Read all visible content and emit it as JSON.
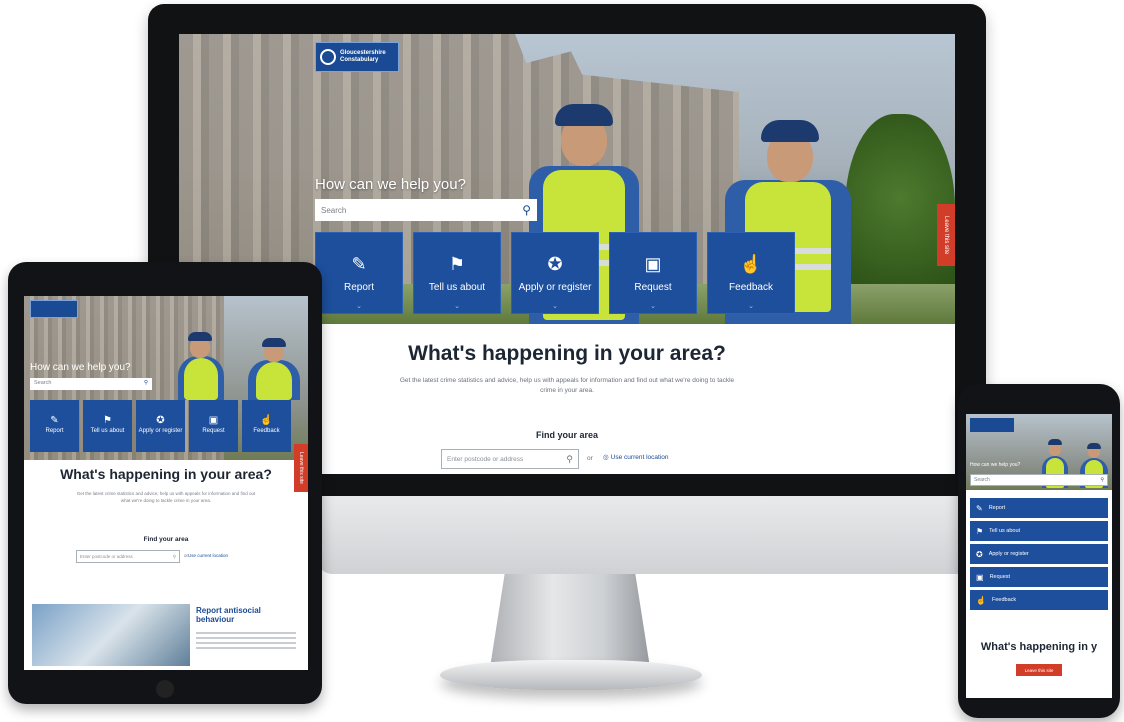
{
  "brand": {
    "line1": "Gloucestershire",
    "line2": "Constabulary"
  },
  "hero": {
    "title": "How can we help you?",
    "search_placeholder": "Search"
  },
  "tiles": [
    {
      "icon": "report-icon",
      "glyph": "✎",
      "label": "Report"
    },
    {
      "icon": "flag-icon",
      "glyph": "⚑",
      "label": "Tell us about"
    },
    {
      "icon": "badge-icon",
      "glyph": "✪",
      "label": "Apply or register"
    },
    {
      "icon": "folder-info-icon",
      "glyph": "▣",
      "label": "Request"
    },
    {
      "icon": "thumbs-icon",
      "glyph": "☝",
      "label": "Feedback"
    }
  ],
  "leave_site": "Leave this site",
  "area": {
    "heading": "What's happening in your area?",
    "description": "Get the latest crime statistics and advice, help us with appeals for information and find out what we're doing to tackle crime in your area.",
    "find_label": "Find your area",
    "postcode_placeholder": "Enter postcode or address",
    "or_label": "or",
    "use_location": "Use current location"
  },
  "tablet_card": {
    "title": "Report antisocial behaviour"
  },
  "phone_heading_fragment": "What's happening in y",
  "colors": {
    "brand_blue": "#1d4f9c",
    "leave_red": "#d23d2a"
  }
}
